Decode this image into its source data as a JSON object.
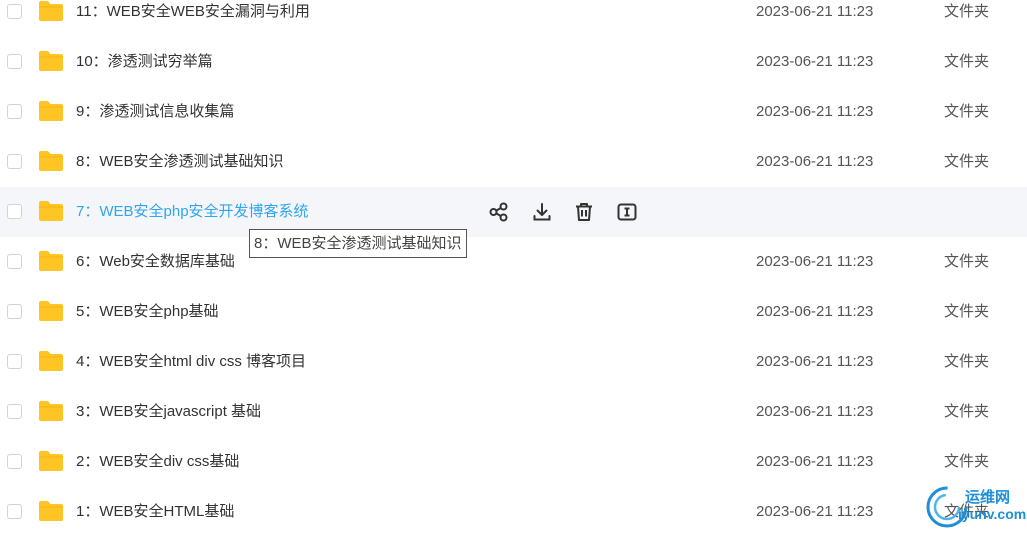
{
  "rows": [
    {
      "name": "11：WEB安全WEB安全漏洞与利用",
      "date": "2023-06-21 11:23",
      "type": "文件夹"
    },
    {
      "name": "10：渗透测试穷举篇",
      "date": "2023-06-21 11:23",
      "type": "文件夹"
    },
    {
      "name": "9：渗透测试信息收集篇",
      "date": "2023-06-21 11:23",
      "type": "文件夹"
    },
    {
      "name": "8：WEB安全渗透测试基础知识",
      "date": "2023-06-21 11:23",
      "type": "文件夹"
    },
    {
      "name": "7：WEB安全php安全开发博客系统",
      "date": "",
      "type": ""
    },
    {
      "name": "6：Web安全数据库基础",
      "date": "2023-06-21 11:23",
      "type": "文件夹"
    },
    {
      "name": "5：WEB安全php基础",
      "date": "2023-06-21 11:23",
      "type": "文件夹"
    },
    {
      "name": "4：WEB安全html div css 博客项目",
      "date": "2023-06-21 11:23",
      "type": "文件夹"
    },
    {
      "name": "3：WEB安全javascript 基础",
      "date": "2023-06-21 11:23",
      "type": "文件夹"
    },
    {
      "name": "2：WEB安全div css基础",
      "date": "2023-06-21 11:23",
      "type": "文件夹"
    },
    {
      "name": "1：WEB安全HTML基础",
      "date": "2023-06-21 11:23",
      "type": "文件夹"
    }
  ],
  "hover_actions": [
    "share-icon",
    "download-icon",
    "delete-icon",
    "rename-icon"
  ],
  "tooltip": "8：WEB安全渗透测试基础知识",
  "watermark": {
    "title": "运维网",
    "domain": "iyunv.com"
  },
  "colors": {
    "folder": "#ffc524",
    "hover_text": "#2ea6f0",
    "hover_bg": "#f5f6f9"
  }
}
